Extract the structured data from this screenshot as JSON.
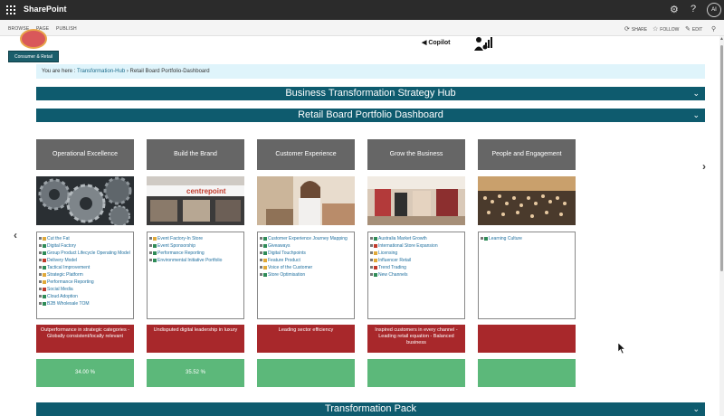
{
  "suite": {
    "app_name": "SharePoint",
    "user_initials": "AI"
  },
  "ribbon": {
    "tabs": [
      "BROWSE",
      "PAGE",
      "PUBLISH"
    ],
    "actions": {
      "share": "SHARE",
      "follow": "FOLLOW",
      "edit": "EDIT"
    }
  },
  "logo": {
    "label": "Consumer & Retail"
  },
  "copilot": {
    "label": "Copilot"
  },
  "breadcrumb": {
    "prefix": "You are here :",
    "link": "Transformation-Hub",
    "separator": "›",
    "current": "Retail Board Portfolio-Dashboard"
  },
  "sections": {
    "hub": "Business Transformation Strategy Hub",
    "dashboard": "Retail Board Portfolio Dashboard",
    "pack": "Transformation Pack"
  },
  "columns": [
    {
      "title": "Operational Excellence",
      "image": "gears",
      "items": [
        {
          "label": "Cut the Fat",
          "color": "#e0a93a"
        },
        {
          "label": "Digital Factory",
          "color": "#2e8b57"
        },
        {
          "label": "Group Product Lifecycle Operating Model",
          "color": "#2e8b57"
        },
        {
          "label": "Delivery Model",
          "color": "#c0392b"
        },
        {
          "label": "Tactical Improvement",
          "color": "#2e8b57"
        },
        {
          "label": "Strategic Platform",
          "color": "#e0a93a"
        },
        {
          "label": "Performance Reporting",
          "color": "#e0a93a"
        },
        {
          "label": "Social Media",
          "color": "#c0392b"
        },
        {
          "label": "Cloud Adoption",
          "color": "#2e8b57"
        },
        {
          "label": "B2B Wholesale TOM",
          "color": "#2e8b57"
        }
      ],
      "outcome": "Outperformance in strategic categories - Globally consistent/locally relevant",
      "progress": "34.00 %"
    },
    {
      "title": "Build the Brand",
      "image": "storefront",
      "items": [
        {
          "label": "Event Factory-In Store",
          "color": "#e0a93a"
        },
        {
          "label": "Event Sponsorship",
          "color": "#2e8b57"
        },
        {
          "label": "Performance Reporting",
          "color": "#2e8b57"
        },
        {
          "label": "Environmental Initiative Portfolio",
          "color": "#2e8b57"
        }
      ],
      "outcome": "Undisputed digital leadership in luxury",
      "progress": "35.52 %"
    },
    {
      "title": "Customer Experience",
      "image": "shopper",
      "items": [
        {
          "label": "Customer Experience Journey Mapping",
          "color": "#2e8b57"
        },
        {
          "label": "Giveaways",
          "color": "#2e8b57"
        },
        {
          "label": "Digital Touchpoints",
          "color": "#2e8b57"
        },
        {
          "label": "Feature Product",
          "color": "#e0a93a"
        },
        {
          "label": "Voice of the Customer",
          "color": "#e0a93a"
        },
        {
          "label": "Store Optimisation",
          "color": "#2e8b57"
        }
      ],
      "outcome": "Leading sector efficiency",
      "progress": ""
    },
    {
      "title": "Grow the Business",
      "image": "store-interior",
      "items": [
        {
          "label": "Australia Market Growth",
          "color": "#2e8b57"
        },
        {
          "label": "International Store Expansion",
          "color": "#c0392b"
        },
        {
          "label": "Licensing",
          "color": "#e0a93a"
        },
        {
          "label": "Influencer Retail",
          "color": "#e0a93a"
        },
        {
          "label": "Trend Trading",
          "color": "#c0392b"
        },
        {
          "label": "New Channels",
          "color": "#2e8b57"
        }
      ],
      "outcome": "Inspired customers in every channel - Leading retail equation - Balanced business",
      "progress": ""
    },
    {
      "title": "People and Engagement",
      "image": "crowd",
      "items": [
        {
          "label": "Learning Culture",
          "color": "#2e8b57"
        }
      ],
      "outcome": "",
      "progress": ""
    }
  ]
}
